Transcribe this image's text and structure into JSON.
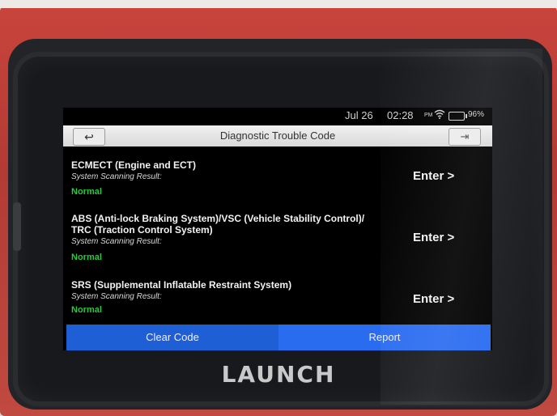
{
  "status": {
    "date": "Jul 26",
    "time": "02:28",
    "ampm": "PM",
    "battery": "96%"
  },
  "header": {
    "title": "Diagnostic Trouble Code",
    "back_icon": "↩",
    "exit_icon": "⇥"
  },
  "systems": [
    {
      "name": "ECMECT (Engine and ECT)",
      "scan_label": "System Scanning Result:",
      "result": "Normal",
      "action": "Enter >"
    },
    {
      "name": "ABS (Anti-lock Braking System)/VSC (Vehicle Stability Control)/ TRC (Traction Control System)",
      "scan_label": "System Scanning Result:",
      "result": "Normal",
      "action": "Enter >"
    },
    {
      "name": "SRS (Supplemental Inflatable Restraint System)",
      "scan_label": "System Scanning Result:",
      "result": "Normal",
      "action": "Enter >"
    }
  ],
  "footer": {
    "clear_label": "Clear Code",
    "report_label": "Report"
  },
  "brand": "LAUNCH"
}
